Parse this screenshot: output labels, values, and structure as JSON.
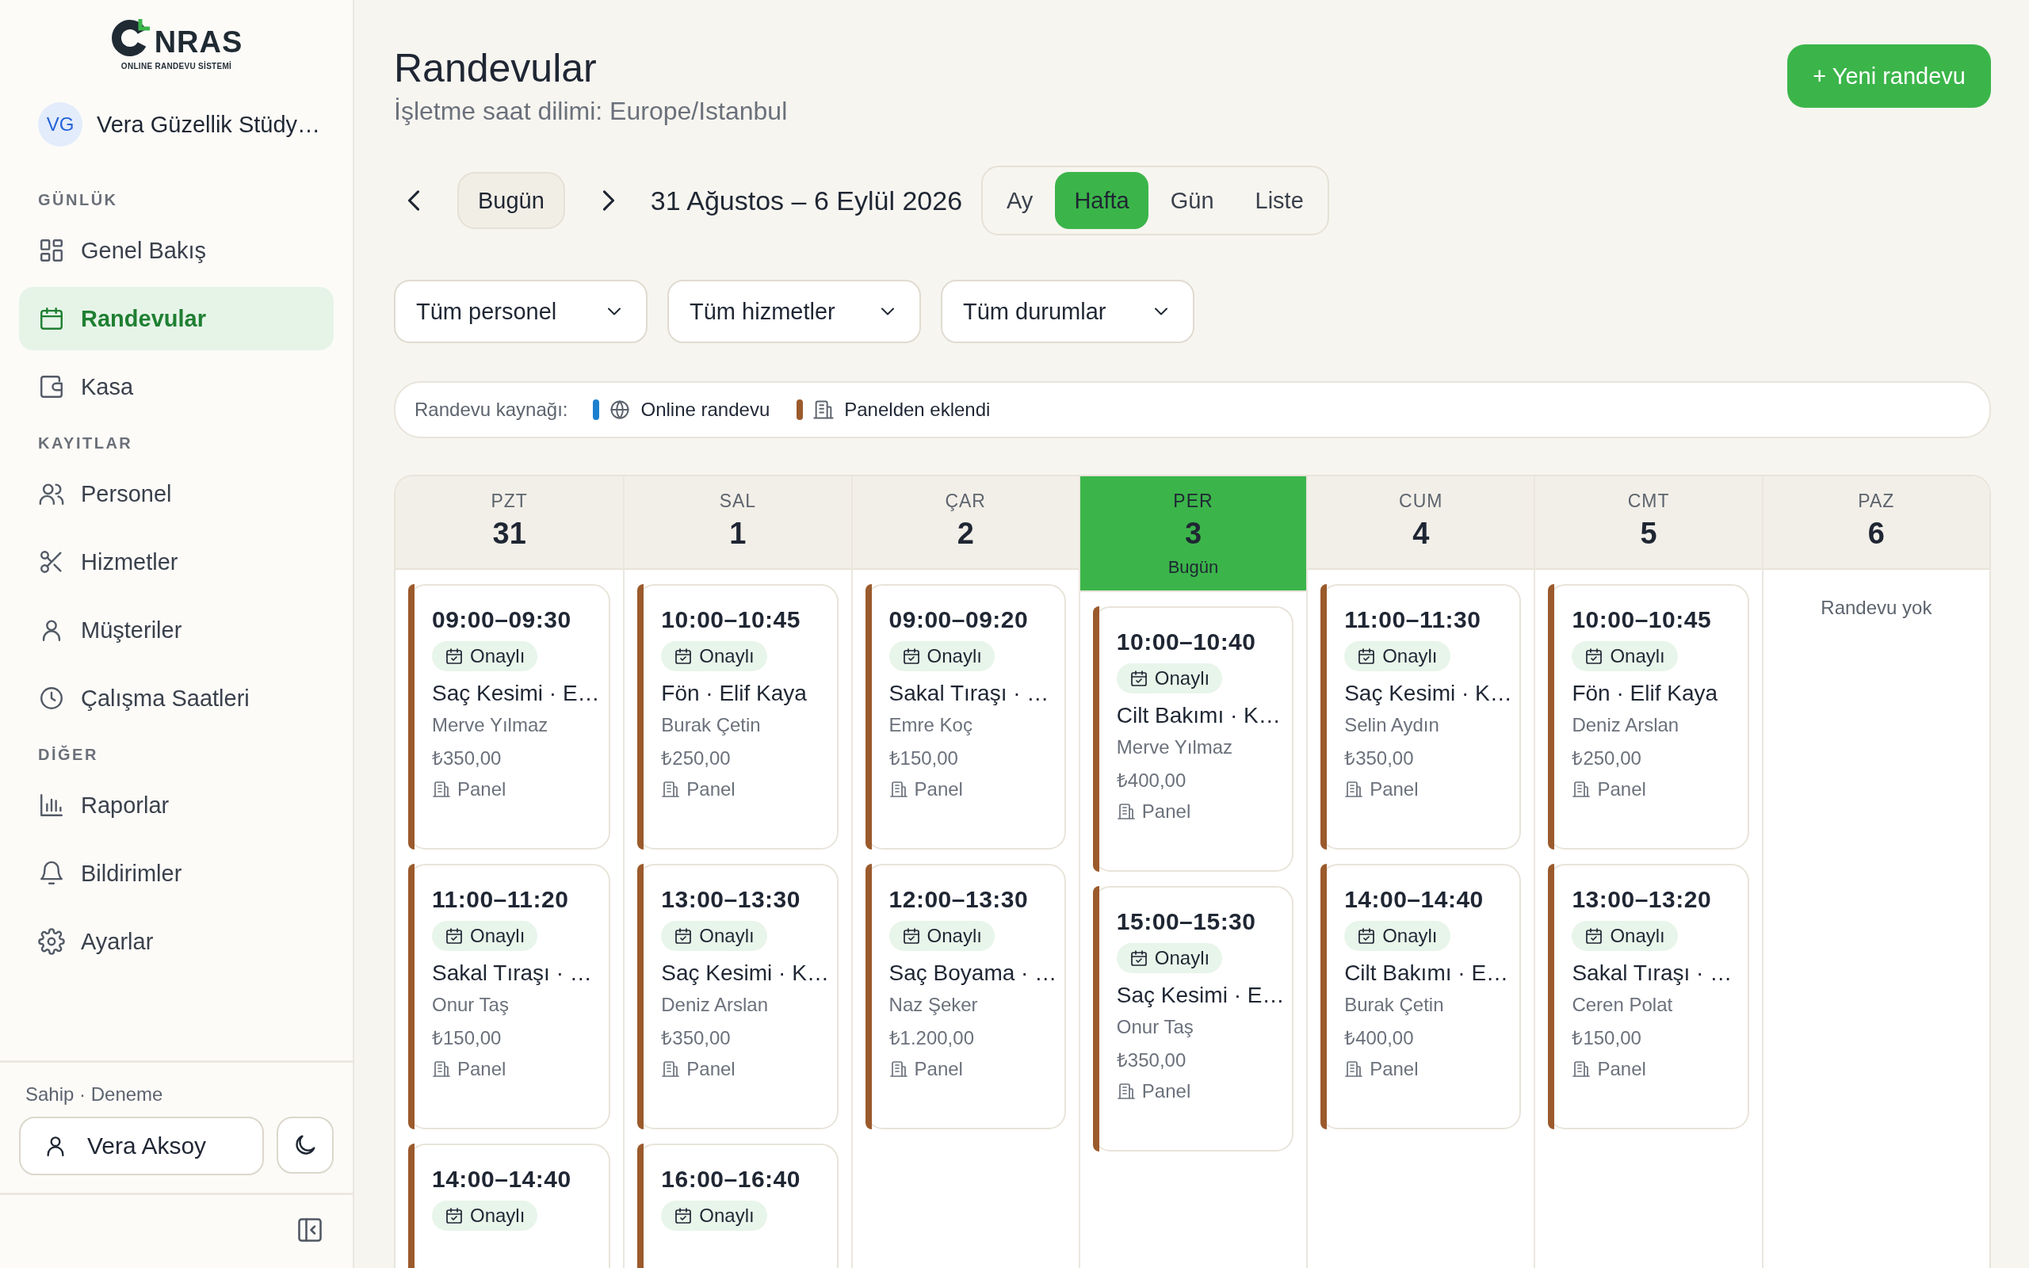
{
  "logo": {
    "wordmark": "NRAS",
    "tagline": "ONLINE RANDEVU SİSTEMİ"
  },
  "business": {
    "initials": "VG",
    "name": "Vera Güzellik Stüdy…"
  },
  "nav": [
    {
      "label": "GÜNLÜK",
      "items": [
        {
          "label": "Genel Bakış",
          "selected": false
        },
        {
          "label": "Randevular",
          "selected": true
        },
        {
          "label": "Kasa",
          "selected": false
        }
      ]
    },
    {
      "label": "KAYITLAR",
      "items": [
        {
          "label": "Personel",
          "selected": false
        },
        {
          "label": "Hizmetler",
          "selected": false
        },
        {
          "label": "Müşteriler",
          "selected": false
        },
        {
          "label": "Çalışma Saatleri",
          "selected": false
        }
      ]
    },
    {
      "label": "DİĞER",
      "items": [
        {
          "label": "Raporlar",
          "selected": false
        },
        {
          "label": "Bildirimler",
          "selected": false
        },
        {
          "label": "Ayarlar",
          "selected": false
        }
      ]
    }
  ],
  "account": {
    "role": "Sahip · Deneme",
    "user": "Vera Aksoy"
  },
  "page": {
    "title": "Randevular",
    "subtitle": "İşletme saat dilimi: Europe/Istanbul",
    "new_button": "+ Yeni randevu"
  },
  "toolbar": {
    "today_button": "Bugün",
    "range": "31 Ağustos – 6 Eylül 2026",
    "views": [
      {
        "label": "Ay",
        "selected": false
      },
      {
        "label": "Hafta",
        "selected": true
      },
      {
        "label": "Gün",
        "selected": false
      },
      {
        "label": "Liste",
        "selected": false
      }
    ]
  },
  "filters": [
    {
      "value": "Tüm personel"
    },
    {
      "value": "Tüm hizmetler"
    },
    {
      "value": "Tüm durumlar"
    }
  ],
  "legend": {
    "label": "Randevu kaynağı:",
    "items": [
      {
        "label": "Online randevu",
        "color": "#1c80d0"
      },
      {
        "label": "Panelden eklendi",
        "color": "#9b5a2c"
      }
    ]
  },
  "days": [
    {
      "weekday": "PZT",
      "date": "31",
      "today": false,
      "appointments": [
        {
          "time": "09:00–09:30",
          "status": "Onaylı",
          "title": "Saç Kesimi · E…",
          "staff": "Merve Yılmaz",
          "price": "₺350,00",
          "source": "Panel",
          "color": "#9b5a2c"
        },
        {
          "time": "11:00–11:20",
          "status": "Onaylı",
          "title": "Sakal Tıraşı · …",
          "staff": "Onur Taş",
          "price": "₺150,00",
          "source": "Panel",
          "color": "#9b5a2c"
        },
        {
          "time": "14:00–14:40",
          "status": "Onaylı",
          "color": "#9b5a2c"
        }
      ]
    },
    {
      "weekday": "SAL",
      "date": "1",
      "today": false,
      "appointments": [
        {
          "time": "10:00–10:45",
          "status": "Onaylı",
          "title": "Fön · Elif Kaya",
          "staff": "Burak Çetin",
          "price": "₺250,00",
          "source": "Panel",
          "color": "#9b5a2c"
        },
        {
          "time": "13:00–13:30",
          "status": "Onaylı",
          "title": "Saç Kesimi · K…",
          "staff": "Deniz Arslan",
          "price": "₺350,00",
          "source": "Panel",
          "color": "#9b5a2c"
        },
        {
          "time": "16:00–16:40",
          "status": "Onaylı",
          "color": "#9b5a2c"
        }
      ]
    },
    {
      "weekday": "ÇAR",
      "date": "2",
      "today": false,
      "appointments": [
        {
          "time": "09:00–09:20",
          "status": "Onaylı",
          "title": "Sakal Tıraşı · …",
          "staff": "Emre Koç",
          "price": "₺150,00",
          "source": "Panel",
          "color": "#9b5a2c"
        },
        {
          "time": "12:00–13:30",
          "status": "Onaylı",
          "title": "Saç Boyama · …",
          "staff": "Naz Şeker",
          "price": "₺1.200,00",
          "source": "Panel",
          "color": "#9b5a2c"
        }
      ]
    },
    {
      "weekday": "PER",
      "date": "3",
      "today": true,
      "today_label": "Bugün",
      "appointments": [
        {
          "time": "10:00–10:40",
          "status": "Onaylı",
          "title": "Cilt Bakımı · K…",
          "staff": "Merve Yılmaz",
          "price": "₺400,00",
          "source": "Panel",
          "color": "#9b5a2c"
        },
        {
          "time": "15:00–15:30",
          "status": "Onaylı",
          "title": "Saç Kesimi · E…",
          "staff": "Onur Taş",
          "price": "₺350,00",
          "source": "Panel",
          "color": "#9b5a2c"
        }
      ]
    },
    {
      "weekday": "CUM",
      "date": "4",
      "today": false,
      "appointments": [
        {
          "time": "11:00–11:30",
          "status": "Onaylı",
          "title": "Saç Kesimi · K…",
          "staff": "Selin Aydın",
          "price": "₺350,00",
          "source": "Panel",
          "color": "#9b5a2c"
        },
        {
          "time": "14:00–14:40",
          "status": "Onaylı",
          "title": "Cilt Bakımı · E…",
          "staff": "Burak Çetin",
          "price": "₺400,00",
          "source": "Panel",
          "color": "#9b5a2c"
        }
      ]
    },
    {
      "weekday": "CMT",
      "date": "5",
      "today": false,
      "appointments": [
        {
          "time": "10:00–10:45",
          "status": "Onaylı",
          "title": "Fön · Elif Kaya",
          "staff": "Deniz Arslan",
          "price": "₺250,00",
          "source": "Panel",
          "color": "#9b5a2c"
        },
        {
          "time": "13:00–13:20",
          "status": "Onaylı",
          "title": "Sakal Tıraşı · …",
          "staff": "Ceren Polat",
          "price": "₺150,00",
          "source": "Panel",
          "color": "#9b5a2c"
        }
      ]
    },
    {
      "weekday": "PAZ",
      "date": "6",
      "today": false,
      "empty_text": "Randevu yok"
    }
  ]
}
